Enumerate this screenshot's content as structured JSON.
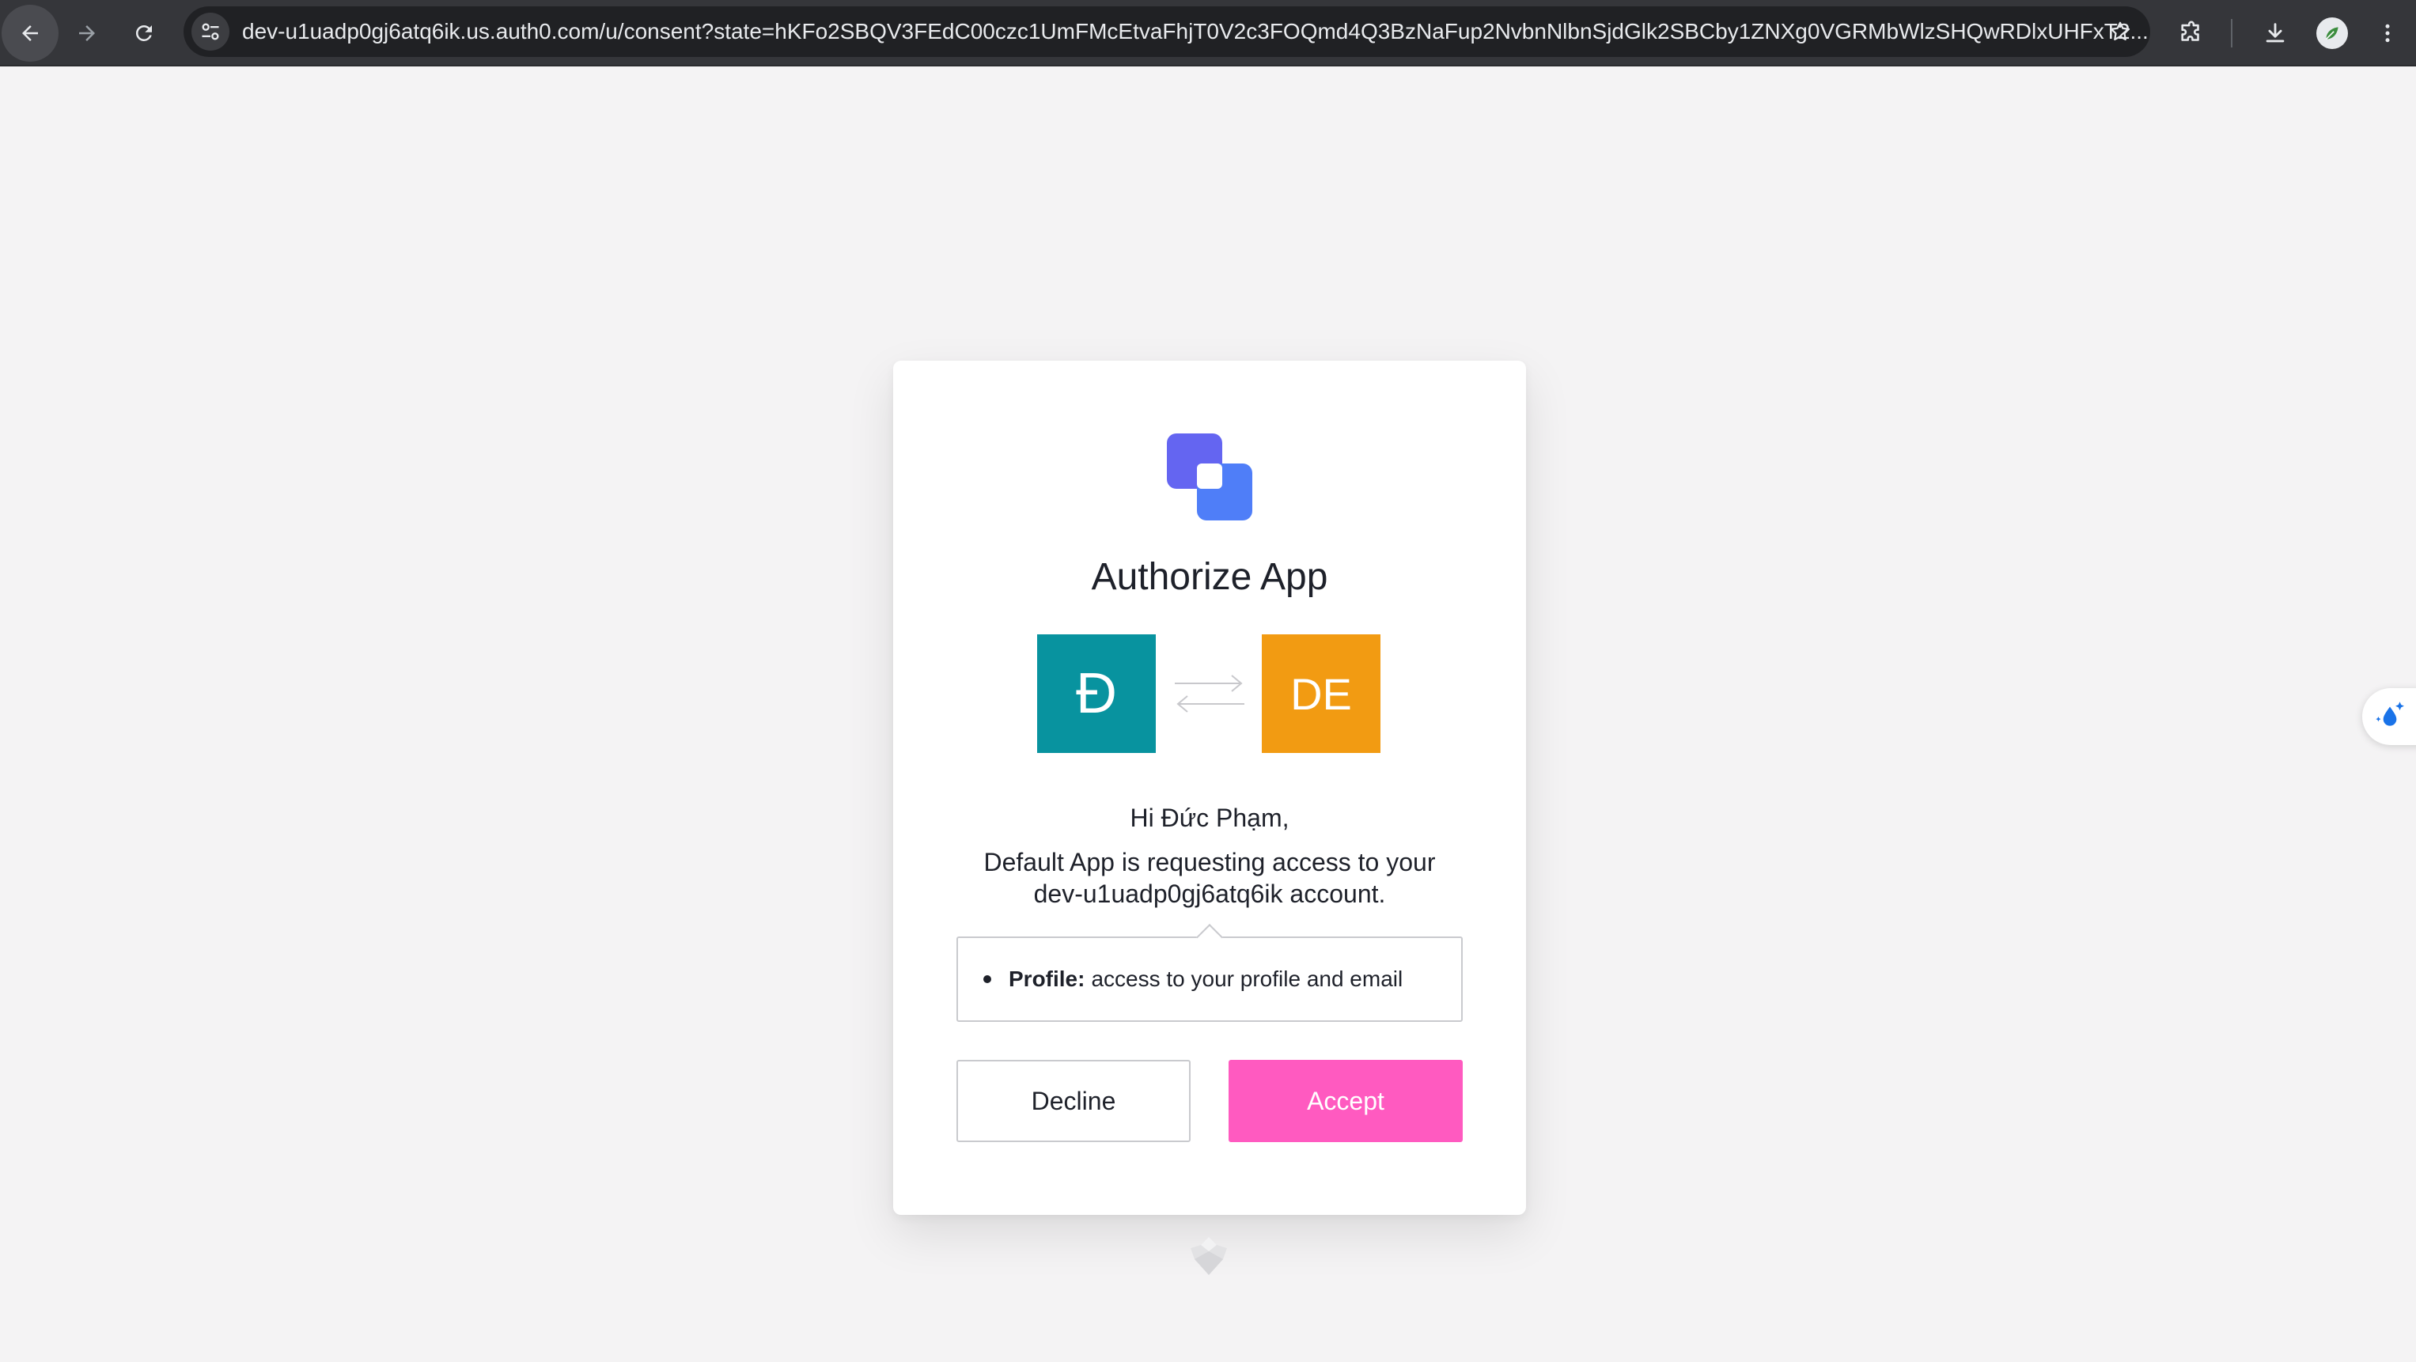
{
  "browser": {
    "url": "dev-u1uadp0gj6atq6ik.us.auth0.com/u/consent?state=hKFo2SBQV3FEdC00czc1UmFMcEtvaFhjT0V2c3FOQmd4Q3BzNaFup2NvbnNlbnSjdGlk2SBCby1ZNXg0VGRMbWlzSHQwRDlxUHFxT2..."
  },
  "consent": {
    "title": "Authorize App",
    "client_initials": "Đ",
    "tenant_initials": "DE",
    "greeting": "Hi Đức Phạm,",
    "request_text": "Default App is requesting access to your dev-u1uadp0gj6atq6ik account.",
    "scopes": [
      {
        "name": "Profile:",
        "description": "access to your profile and email"
      }
    ],
    "decline_label": "Decline",
    "accept_label": "Accept"
  },
  "colors": {
    "client_tile": "#08939f",
    "tenant_tile": "#f29b12",
    "accept_button": "#ff5ac0",
    "logo_primary": "#6465f1",
    "logo_secondary": "#4f7ef8"
  }
}
